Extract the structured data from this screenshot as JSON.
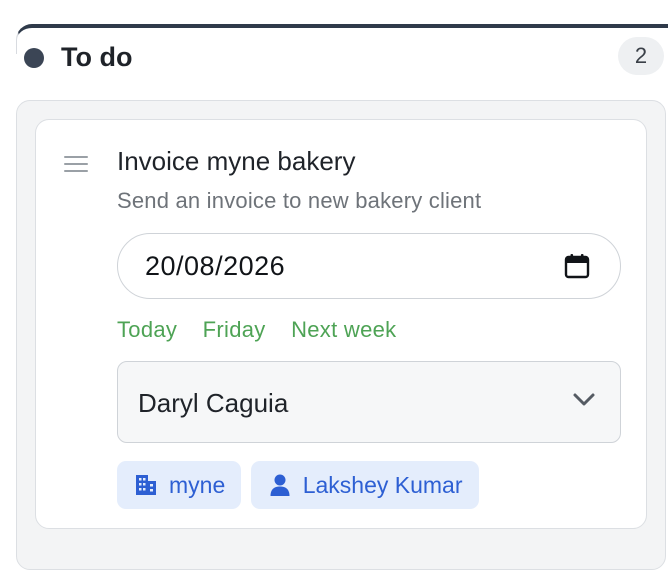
{
  "column": {
    "title": "To do",
    "count": "2",
    "accent_color": "#2f3a4a"
  },
  "card": {
    "title": "Invoice myne bakery",
    "description": "Send an invoice to new bakery client",
    "due_date": "20/08/2026",
    "quick_dates": [
      "Today",
      "Friday",
      "Next week"
    ],
    "assignee": "Daryl Caguia",
    "tags": [
      {
        "label": "myne",
        "icon": "building-icon"
      },
      {
        "label": "Lakshey Kumar",
        "icon": "person-icon"
      }
    ]
  },
  "colors": {
    "quick_date_link": "#4ea355",
    "tag_text": "#2d5fd3",
    "tag_background": "#e4edfc"
  }
}
